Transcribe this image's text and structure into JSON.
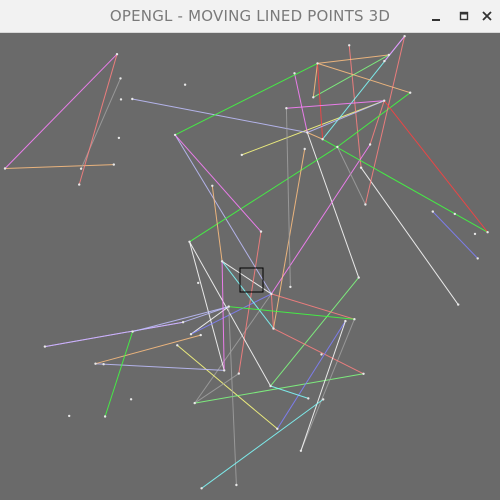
{
  "window": {
    "title": "OPENGL - MOVING LINED POINTS 3D",
    "controls": [
      {
        "name": "minimize",
        "icon": "minimize-icon"
      },
      {
        "name": "maximize",
        "icon": "maximize-icon"
      },
      {
        "name": "close",
        "icon": "close-icon"
      }
    ]
  },
  "scene": {
    "background_color": "#6a6a6a",
    "line_colors": [
      "#ff80ff",
      "#80ff80",
      "#ffffff",
      "#8080ff",
      "#ff8080",
      "#80ffff",
      "#ffff80",
      "#ff4040",
      "#40ff40",
      "#c0c0ff",
      "#ffc080",
      "#a0a0a0"
    ]
  }
}
